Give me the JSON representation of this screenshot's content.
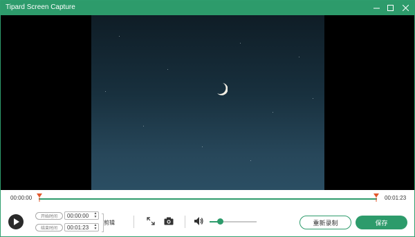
{
  "window": {
    "title": "Tipard Screen Capture",
    "controls": [
      "minimize-icon",
      "maximize-icon",
      "close-icon"
    ]
  },
  "player": {
    "current_time": "00:00:00",
    "total_time": "00:01:23"
  },
  "clip": {
    "start_label": "开始时间",
    "start_value": "00:00:00",
    "end_label": "结束时间",
    "end_value": "00:01:23",
    "clip_label": "剪辑"
  },
  "volume": {
    "level": 0.22
  },
  "actions": {
    "rerecord_label": "重新录制",
    "save_label": "保存"
  },
  "colors": {
    "accent": "#2d9b6b",
    "marker": "#e2572b"
  }
}
